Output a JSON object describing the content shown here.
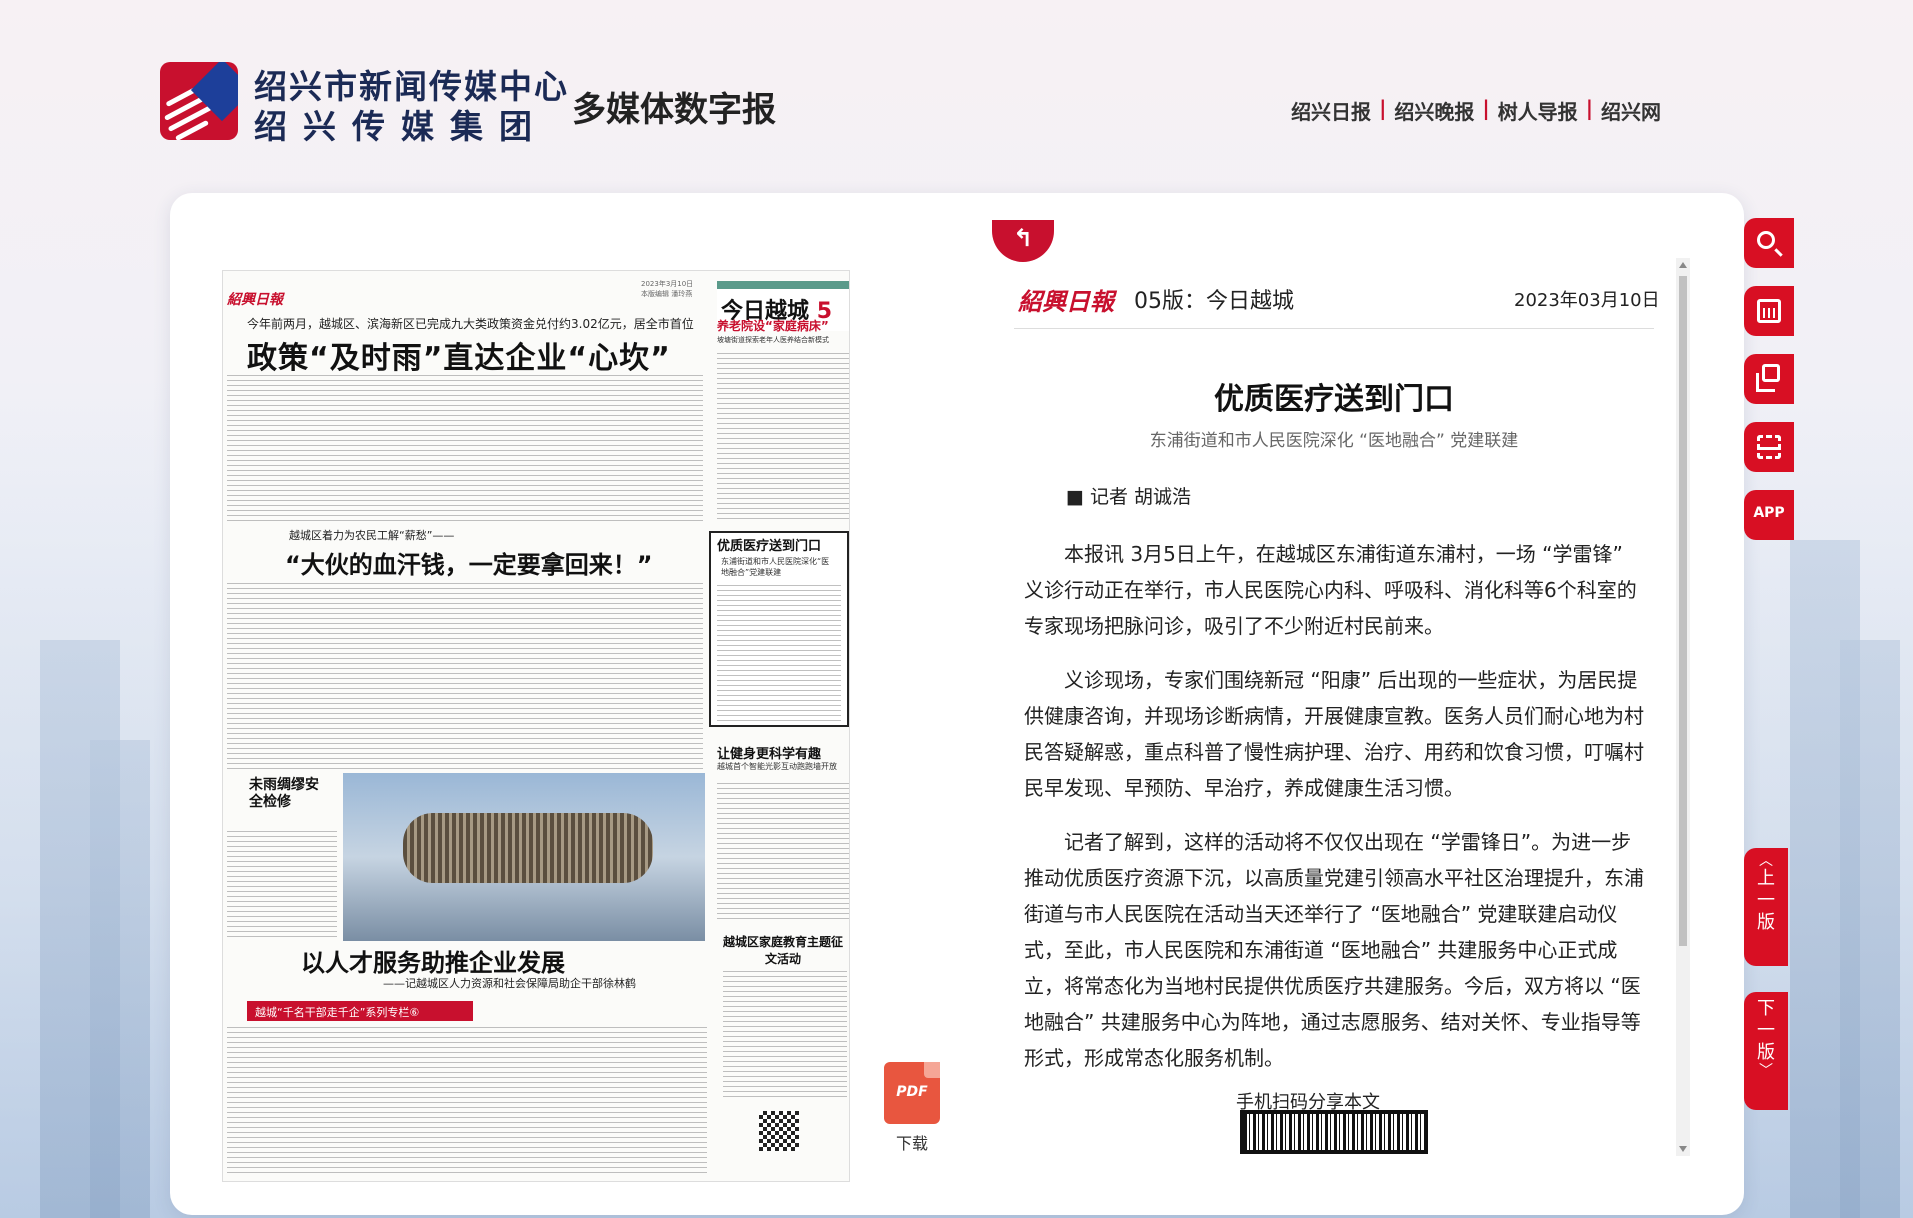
{
  "header": {
    "logo_line1": "绍兴市新闻传媒中心",
    "logo_line2": "绍兴传媒集团",
    "site_title": "多媒体数字报",
    "links": [
      "绍兴日报",
      "绍兴晚报",
      "树人导报",
      "绍兴网"
    ],
    "link_separator": "|"
  },
  "newspaper": {
    "brand": "紹興日報",
    "meta_date": "2023年3月10日",
    "meta_editor": "本版编辑 潘玲燕",
    "section_name": "今日越城",
    "section_num": "5",
    "kicker": "今年前两月，越城区、滨海新区已完成九大类政策资金兑付约3.02亿元，居全市首位",
    "headline": "政策“及时雨”直达企业“心坎”",
    "side_headline": "养老院设“家庭病床”",
    "side_sub": "坡塘街道探索老年人医养结合新模式",
    "kicker2": "越城区着力为农民工解“薪愁”——",
    "headline2": "“大伙的血汗钱，一定要拿回来！”",
    "box_title": "优质医疗送到门口",
    "box_sub": "东浦街道和市人民医院深化“医地融合”党建联建",
    "fitness_title": "让健身更科学有趣",
    "fitness_sub": "越城首个智能光影互动跑跑墙开放",
    "family_title": "越城区家庭教育主题征文活动",
    "warn": "未雨绸缪安全检修",
    "headline3": "以人才服务助推企业发展",
    "headline3_sub": "——记越城区人力资源和社会保障局助企干部徐林鹤",
    "series": "越城“千名干部走千企”系列专栏⑥"
  },
  "download": {
    "icon_text": "PDF",
    "label": "下载"
  },
  "article": {
    "brand": "紹興日報",
    "page": "05版：今日越城",
    "date": "2023年03月10日",
    "title": "优质医疗送到门口",
    "subtitle": "东浦街道和市人民医院深化 “医地融合” 党建联建",
    "author": "■ 记者 胡诚浩",
    "paragraphs": [
      "本报讯 3月5日上午，在越城区东浦街道东浦村，一场 “学雷锋” 义诊行动正在举行，市人民医院心内科、呼吸科、消化科等6个科室的专家现场把脉问诊，吸引了不少附近村民前来。",
      "义诊现场，专家们围绕新冠 “阳康” 后出现的一些症状，为居民提供健康咨询，并现场诊断病情，开展健康宣教。医务人员们耐心地为村民答疑解惑，重点科普了慢性病护理、治疗、用药和饮食习惯，叮嘱村民早发现、早预防、早治疗，养成健康生活习惯。",
      "记者了解到，这样的活动将不仅仅出现在 “学雷锋日”。为进一步推动优质医疗资源下沉，以高质量党建引领高水平社区治理提升，东浦街道与市人民医院在活动当天还举行了 “医地融合” 党建联建启动仪式，至此，市人民医院和东浦街道 “医地融合” 共建服务中心正式成立，将常态化为当地村民提供优质医疗共建服务。今后，双方将以 “医地融合” 共建服务中心为阵地，通过志愿服务、结对关怀、专业指导等形式，形成常态化服务机制。"
    ],
    "qr_label": "手机扫码分享本文"
  },
  "tools": {
    "app_label": "APP",
    "prev_page": "上一版",
    "next_page": "下一版"
  },
  "colors": {
    "accent": "#d80f23",
    "brand_red": "#c8102e",
    "logo_blue": "#1b2a55"
  }
}
